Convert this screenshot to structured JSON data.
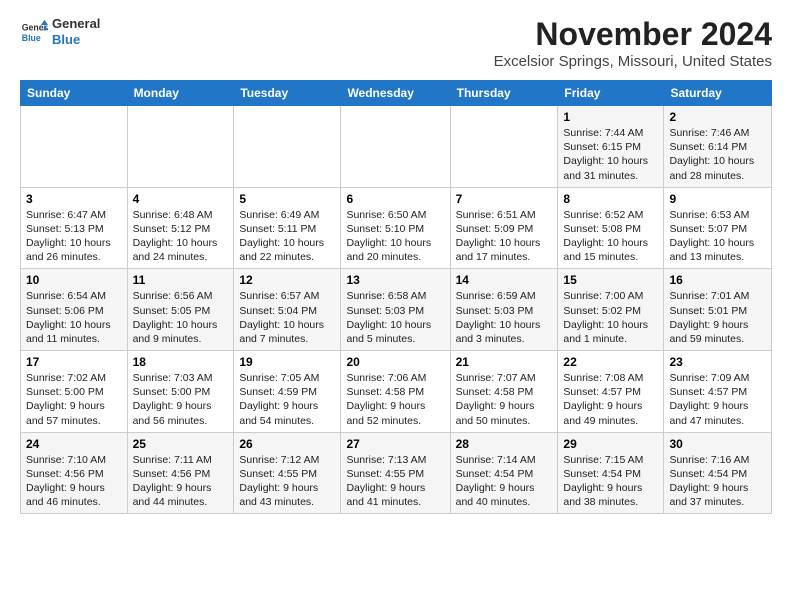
{
  "header": {
    "logo_general": "General",
    "logo_blue": "Blue",
    "title": "November 2024",
    "subtitle": "Excelsior Springs, Missouri, United States"
  },
  "weekdays": [
    "Sunday",
    "Monday",
    "Tuesday",
    "Wednesday",
    "Thursday",
    "Friday",
    "Saturday"
  ],
  "weeks": [
    [
      {
        "day": "",
        "text": ""
      },
      {
        "day": "",
        "text": ""
      },
      {
        "day": "",
        "text": ""
      },
      {
        "day": "",
        "text": ""
      },
      {
        "day": "",
        "text": ""
      },
      {
        "day": "1",
        "text": "Sunrise: 7:44 AM\nSunset: 6:15 PM\nDaylight: 10 hours and 31 minutes."
      },
      {
        "day": "2",
        "text": "Sunrise: 7:46 AM\nSunset: 6:14 PM\nDaylight: 10 hours and 28 minutes."
      }
    ],
    [
      {
        "day": "3",
        "text": "Sunrise: 6:47 AM\nSunset: 5:13 PM\nDaylight: 10 hours and 26 minutes."
      },
      {
        "day": "4",
        "text": "Sunrise: 6:48 AM\nSunset: 5:12 PM\nDaylight: 10 hours and 24 minutes."
      },
      {
        "day": "5",
        "text": "Sunrise: 6:49 AM\nSunset: 5:11 PM\nDaylight: 10 hours and 22 minutes."
      },
      {
        "day": "6",
        "text": "Sunrise: 6:50 AM\nSunset: 5:10 PM\nDaylight: 10 hours and 20 minutes."
      },
      {
        "day": "7",
        "text": "Sunrise: 6:51 AM\nSunset: 5:09 PM\nDaylight: 10 hours and 17 minutes."
      },
      {
        "day": "8",
        "text": "Sunrise: 6:52 AM\nSunset: 5:08 PM\nDaylight: 10 hours and 15 minutes."
      },
      {
        "day": "9",
        "text": "Sunrise: 6:53 AM\nSunset: 5:07 PM\nDaylight: 10 hours and 13 minutes."
      }
    ],
    [
      {
        "day": "10",
        "text": "Sunrise: 6:54 AM\nSunset: 5:06 PM\nDaylight: 10 hours and 11 minutes."
      },
      {
        "day": "11",
        "text": "Sunrise: 6:56 AM\nSunset: 5:05 PM\nDaylight: 10 hours and 9 minutes."
      },
      {
        "day": "12",
        "text": "Sunrise: 6:57 AM\nSunset: 5:04 PM\nDaylight: 10 hours and 7 minutes."
      },
      {
        "day": "13",
        "text": "Sunrise: 6:58 AM\nSunset: 5:03 PM\nDaylight: 10 hours and 5 minutes."
      },
      {
        "day": "14",
        "text": "Sunrise: 6:59 AM\nSunset: 5:03 PM\nDaylight: 10 hours and 3 minutes."
      },
      {
        "day": "15",
        "text": "Sunrise: 7:00 AM\nSunset: 5:02 PM\nDaylight: 10 hours and 1 minute."
      },
      {
        "day": "16",
        "text": "Sunrise: 7:01 AM\nSunset: 5:01 PM\nDaylight: 9 hours and 59 minutes."
      }
    ],
    [
      {
        "day": "17",
        "text": "Sunrise: 7:02 AM\nSunset: 5:00 PM\nDaylight: 9 hours and 57 minutes."
      },
      {
        "day": "18",
        "text": "Sunrise: 7:03 AM\nSunset: 5:00 PM\nDaylight: 9 hours and 56 minutes."
      },
      {
        "day": "19",
        "text": "Sunrise: 7:05 AM\nSunset: 4:59 PM\nDaylight: 9 hours and 54 minutes."
      },
      {
        "day": "20",
        "text": "Sunrise: 7:06 AM\nSunset: 4:58 PM\nDaylight: 9 hours and 52 minutes."
      },
      {
        "day": "21",
        "text": "Sunrise: 7:07 AM\nSunset: 4:58 PM\nDaylight: 9 hours and 50 minutes."
      },
      {
        "day": "22",
        "text": "Sunrise: 7:08 AM\nSunset: 4:57 PM\nDaylight: 9 hours and 49 minutes."
      },
      {
        "day": "23",
        "text": "Sunrise: 7:09 AM\nSunset: 4:57 PM\nDaylight: 9 hours and 47 minutes."
      }
    ],
    [
      {
        "day": "24",
        "text": "Sunrise: 7:10 AM\nSunset: 4:56 PM\nDaylight: 9 hours and 46 minutes."
      },
      {
        "day": "25",
        "text": "Sunrise: 7:11 AM\nSunset: 4:56 PM\nDaylight: 9 hours and 44 minutes."
      },
      {
        "day": "26",
        "text": "Sunrise: 7:12 AM\nSunset: 4:55 PM\nDaylight: 9 hours and 43 minutes."
      },
      {
        "day": "27",
        "text": "Sunrise: 7:13 AM\nSunset: 4:55 PM\nDaylight: 9 hours and 41 minutes."
      },
      {
        "day": "28",
        "text": "Sunrise: 7:14 AM\nSunset: 4:54 PM\nDaylight: 9 hours and 40 minutes."
      },
      {
        "day": "29",
        "text": "Sunrise: 7:15 AM\nSunset: 4:54 PM\nDaylight: 9 hours and 38 minutes."
      },
      {
        "day": "30",
        "text": "Sunrise: 7:16 AM\nSunset: 4:54 PM\nDaylight: 9 hours and 37 minutes."
      }
    ]
  ]
}
